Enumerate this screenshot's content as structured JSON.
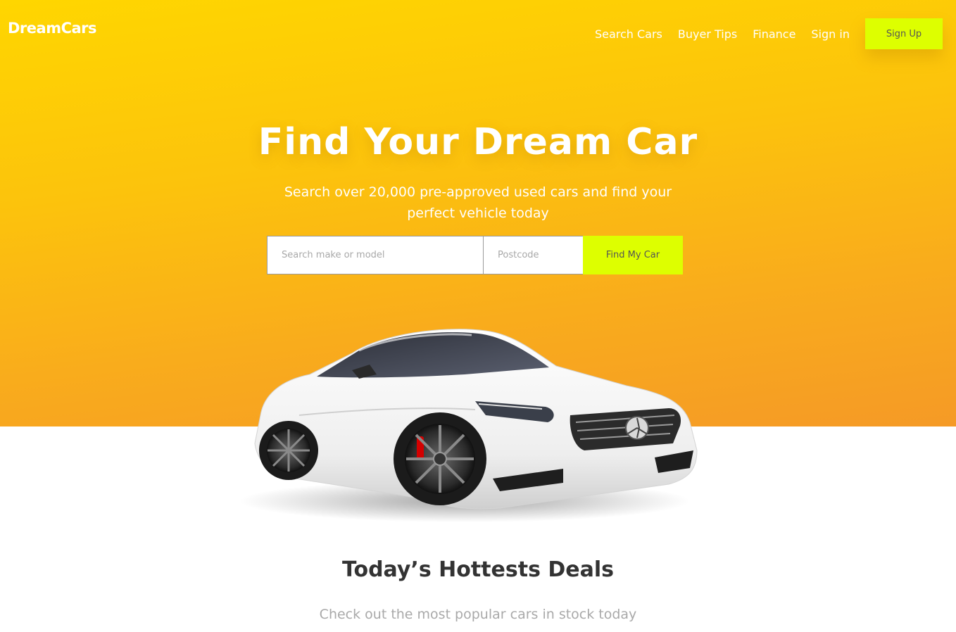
{
  "brand": {
    "logo": "DreamCars"
  },
  "nav": {
    "items": [
      {
        "label": "Search Cars"
      },
      {
        "label": "Buyer Tips"
      },
      {
        "label": "Finance"
      },
      {
        "label": "Sign in"
      }
    ],
    "signup_label": "Sign Up"
  },
  "hero": {
    "title": "Find Your Dream Car",
    "subtitle": "Search over 20,000 pre-approved used cars and find your perfect vehicle today",
    "search": {
      "make_placeholder": "Search make or model",
      "make_value": "",
      "postcode_placeholder": "Postcode",
      "postcode_value": "",
      "button_label": "Find My Car"
    }
  },
  "deals": {
    "title": "Today’s Hottests Deals",
    "subtitle": "Check out the most popular cars in stock today"
  },
  "colors": {
    "hero_gradient_start": "#ffd600",
    "hero_gradient_end": "#f59a26",
    "accent_button": "#ddff00",
    "heading_text": "#333333",
    "muted_text": "#a9a9a9"
  },
  "icons": {
    "hero_image": "white-sports-coupe-image"
  }
}
